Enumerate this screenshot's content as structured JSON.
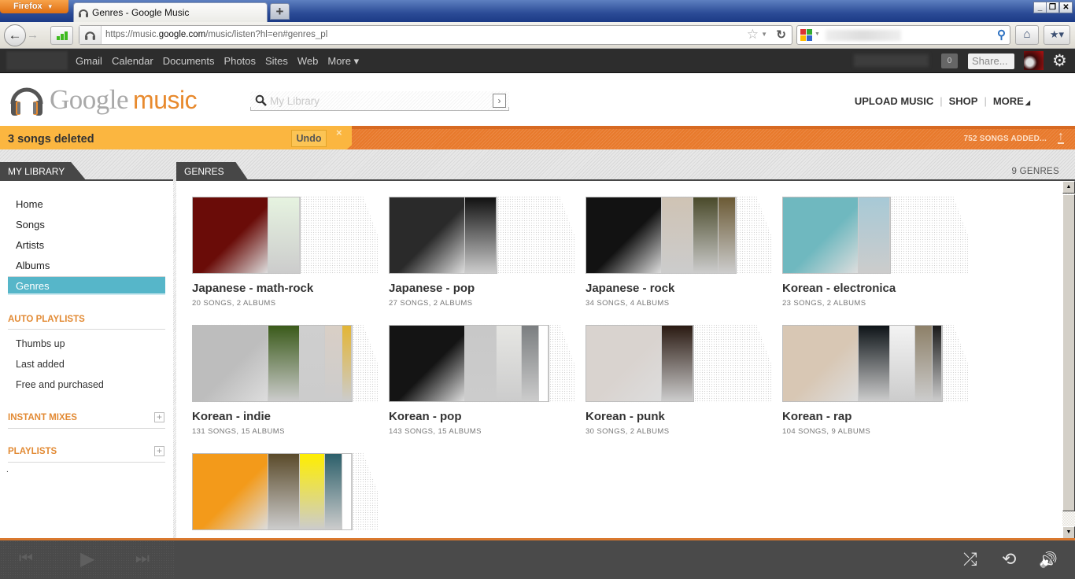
{
  "browser": {
    "menu_label": "Firefox",
    "tab_title": "Genres - Google Music",
    "new_tab_label": "+",
    "url_prefix": "https://music.",
    "url_domain": "google.com",
    "url_suffix": "/music/listen?hl=en#genres_pl",
    "window_controls": [
      "_",
      "❐",
      "✕"
    ]
  },
  "gbar": {
    "links": [
      "Gmail",
      "Calendar",
      "Documents",
      "Photos",
      "Sites",
      "Web",
      "More ▾"
    ],
    "notification_count": "0",
    "share_label": "Share..."
  },
  "header": {
    "logo_word1": "Google",
    "logo_word2": "music",
    "search_placeholder": "My Library",
    "nav": [
      "UPLOAD MUSIC",
      "SHOP",
      "MORE"
    ]
  },
  "notice": {
    "message": "3 songs deleted",
    "undo_label": "Undo",
    "dismiss_label": "×",
    "upload_status": "752 SONGS ADDED..."
  },
  "sidebar": {
    "header": "MY LIBRARY",
    "items": [
      {
        "label": "Home"
      },
      {
        "label": "Songs"
      },
      {
        "label": "Artists"
      },
      {
        "label": "Albums"
      },
      {
        "label": "Genres",
        "active": true
      }
    ],
    "auto_playlists_label": "AUTO PLAYLISTS",
    "auto_playlists": [
      "Thumbs up",
      "Last added",
      "Free and purchased"
    ],
    "instant_mixes_label": "INSTANT MIXES",
    "playlists_label": "PLAYLISTS",
    "playlists_placeholder": "."
  },
  "main": {
    "header": "GENRES",
    "count_label": "9 GENRES",
    "genres": [
      {
        "title": "Japanese - math-rock",
        "meta": "20 SONGS, 2 ALBUMS",
        "covers": [
          "#6a0c08",
          "#e6f3e0"
        ]
      },
      {
        "title": "Japanese - pop",
        "meta": "27 SONGS, 2 ALBUMS",
        "covers": [
          "#2a2a2a",
          "#111111"
        ]
      },
      {
        "title": "Japanese - rock",
        "meta": "34 SONGS, 4 ALBUMS",
        "covers": [
          "#121212",
          "#cfc3b4",
          "#4a4a2a",
          "#6b5a35"
        ]
      },
      {
        "title": "Korean - electronica",
        "meta": "23 SONGS, 2 ALBUMS",
        "covers": [
          "#6fb8bf",
          "#a7c9d6"
        ]
      },
      {
        "title": "Korean - indie",
        "meta": "131 SONGS, 15 ALBUMS",
        "covers": [
          "#bdbdbd",
          "#3a5a1a",
          "#cfcfcf",
          "#d9cfc6",
          "#e3b535"
        ]
      },
      {
        "title": "Korean - pop",
        "meta": "143 SONGS, 15 ALBUMS",
        "covers": [
          "#141414",
          "#c8c8c8",
          "#e6e6e3",
          "#7b7e80",
          "#ffffff"
        ]
      },
      {
        "title": "Korean - punk",
        "meta": "30 SONGS, 2 ALBUMS",
        "covers": [
          "#d9d3cf",
          "#2a1a12"
        ]
      },
      {
        "title": "Korean - rap",
        "meta": "104 SONGS, 9 ALBUMS",
        "covers": [
          "#d8c7b4",
          "#0e1418",
          "#f3f3f3",
          "#8d8068",
          "#1a1a1a"
        ]
      },
      {
        "title": "",
        "meta": "",
        "covers": [
          "#f39a1a",
          "#5a4a2a",
          "#ffee00",
          "#2c5f6a",
          "#ffffff"
        ]
      }
    ]
  },
  "player": {
    "prev_icon": "⏮",
    "play_icon": "▶",
    "next_icon": "⏭",
    "shuffle_icon": "⤮",
    "repeat_icon": "⟲",
    "volume_icon": "🔊"
  }
}
